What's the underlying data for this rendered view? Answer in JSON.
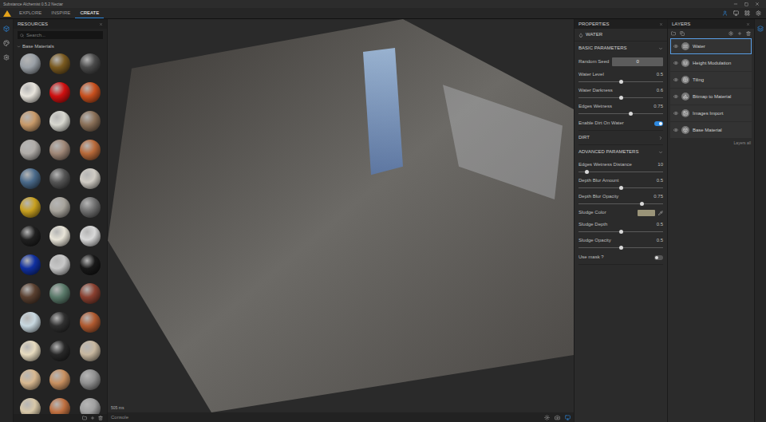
{
  "window": {
    "title": "Substance Alchemist 0.5.2 Nectar"
  },
  "nav": {
    "tabs": [
      {
        "label": "EXPLORE",
        "selected": false
      },
      {
        "label": "INSPIRE",
        "selected": false
      },
      {
        "label": "CREATE",
        "selected": true
      }
    ]
  },
  "resources": {
    "title": "RESOURCES",
    "search": {
      "placeholder": "Search..."
    },
    "section": {
      "label": "Base Materials",
      "expanded": true
    },
    "materials": [
      {
        "color": "#9aa0a6"
      },
      {
        "color": "#7a5a20"
      },
      {
        "color": "#4a4a4a"
      },
      {
        "color": "#e8e4dc"
      },
      {
        "color": "#d01010"
      },
      {
        "color": "#c8501e"
      },
      {
        "color": "#c89a6a"
      },
      {
        "color": "#d8d8d0"
      },
      {
        "color": "#8a7058"
      },
      {
        "color": "#b0aca8"
      },
      {
        "color": "#a08878"
      },
      {
        "color": "#b86a3a"
      },
      {
        "color": "#4a6a8a"
      },
      {
        "color": "#555555"
      },
      {
        "color": "#d0ccc4"
      },
      {
        "color": "#c8a020"
      },
      {
        "color": "#a8a49c"
      },
      {
        "color": "#707070"
      },
      {
        "color": "#202020"
      },
      {
        "color": "#e8e4d8"
      },
      {
        "color": "#d8d8d8"
      },
      {
        "color": "#1030a0"
      },
      {
        "color": "#c8c8c8"
      },
      {
        "color": "#181818"
      },
      {
        "color": "#5a4030"
      },
      {
        "color": "#5a7a6a"
      },
      {
        "color": "#8a4030"
      },
      {
        "color": "#c8d8e0"
      },
      {
        "color": "#303030"
      },
      {
        "color": "#b05a30"
      },
      {
        "color": "#e8dcc0"
      },
      {
        "color": "#282828"
      },
      {
        "color": "#c8b8a0"
      },
      {
        "color": "#d8b890"
      },
      {
        "color": "#c89060"
      },
      {
        "color": "#909090"
      },
      {
        "color": "#d8c8a8"
      },
      {
        "color": "#c07040"
      },
      {
        "color": "#a0a0a0"
      }
    ]
  },
  "viewport": {
    "timing": "505 ms",
    "console": "Console"
  },
  "properties": {
    "title": "PROPERTIES",
    "layer": "WATER",
    "sections": [
      {
        "label": "BASIC PARAMETERS",
        "expanded": true,
        "rows": [
          {
            "kind": "field",
            "label": "Random Seed",
            "value": "0"
          },
          {
            "kind": "slider",
            "label": "Water Level",
            "value": "0.5",
            "level": 0.5
          },
          {
            "kind": "slider",
            "label": "Water Darkness",
            "value": "0.6",
            "level": 0.5
          },
          {
            "kind": "slider",
            "label": "Edges Wetness",
            "value": "0.75",
            "level": 0.62
          },
          {
            "kind": "toggle",
            "label": "Enable Dirt On Water",
            "on": true
          }
        ]
      },
      {
        "label": "DIRT",
        "expanded": false,
        "rows": []
      },
      {
        "label": "ADVANCED PARAMETERS",
        "expanded": true,
        "rows": [
          {
            "kind": "slider",
            "label": "Edges Wetness Distance",
            "value": "10",
            "level": 0.1
          },
          {
            "kind": "slider",
            "label": "Depth Blur Amount",
            "value": "0.5",
            "level": 0.5
          },
          {
            "kind": "slider",
            "label": "Depth Blur Opacity",
            "value": "0.75",
            "level": 0.75
          },
          {
            "kind": "color",
            "label": "Sludge Color",
            "color": "#9a9478"
          },
          {
            "kind": "slider",
            "label": "Sludge Depth",
            "value": "0.5",
            "level": 0.5
          },
          {
            "kind": "slider",
            "label": "Sludge Opacity",
            "value": "0.5",
            "level": 0.5
          },
          {
            "kind": "toggle",
            "label": "Use mask ?",
            "on": false
          }
        ]
      }
    ]
  },
  "layers": {
    "title": "LAYERS",
    "items": [
      {
        "name": "Water",
        "selected": true
      },
      {
        "name": "Height Modulation",
        "selected": false
      },
      {
        "name": "Tiling",
        "selected": false
      },
      {
        "name": "Bitmap to Material",
        "selected": false
      },
      {
        "name": "Images Import",
        "selected": false
      },
      {
        "name": "Base Material",
        "selected": false
      }
    ],
    "footer": "Layers all"
  }
}
